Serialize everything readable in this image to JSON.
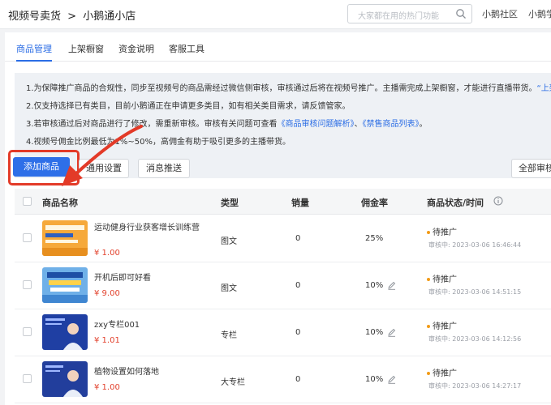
{
  "header": {
    "breadcrumb": [
      "视频号卖货",
      ">",
      "小鹅通小店"
    ],
    "search_placeholder": "大家都在用的热门功能",
    "links": [
      "小鹅社区",
      "小鹅学"
    ]
  },
  "tabs": [
    "商品管理",
    "上架橱窗",
    "资金说明",
    "客服工具"
  ],
  "notice": {
    "line1": "1.为保障推广商品的合规性，同步至视频号的商品需经过微信侧审核，审核通过后将在视频号推广。主播需完成上架橱窗，才能进行直播带货。",
    "line1_link": "“上架",
    "line2": "2.仅支持选择已有类目，目前小鹅通正在申请更多类目，如有相关类目需求，请反馈管家。",
    "line3_a": "3.若审核通过后对商品进行了修改，需重新审核。审核有关问题可查看",
    "line3_link1": "《商品审核问题解析》",
    "line3_sep": "、",
    "line3_link2": "《禁售商品列表》",
    "line3_end": "。",
    "line4": "4.视频号佣金比例最低为1%~50%，高佣金有助于吸引更多的主播带货。"
  },
  "toolbar": {
    "add_label": "添加商品",
    "general_label": "通用设置",
    "push_label": "消息推送",
    "filter_label": "全部审核"
  },
  "table": {
    "columns": [
      "商品名称",
      "类型",
      "销量",
      "佣金率",
      "商品状态/时间"
    ],
    "rows": [
      {
        "name": "运动健身行业获客增长训练营",
        "price": "¥ 1.00",
        "type": "图文",
        "sales": "0",
        "commission": "25%",
        "status": "待推广",
        "time": "审核中: 2023-03-06 16:46:44"
      },
      {
        "name": "开机后即可好看",
        "price": "¥ 9.00",
        "type": "图文",
        "sales": "0",
        "commission": "10%",
        "status": "待推广",
        "time": "审核中: 2023-03-06 14:51:15"
      },
      {
        "name": "zxy专栏001",
        "price": "¥ 1.01",
        "type": "专栏",
        "sales": "0",
        "commission": "10%",
        "status": "待推广",
        "time": "审核中: 2023-03-06 14:12:56"
      },
      {
        "name": "植物设置如何落地",
        "price": "¥ 1.00",
        "type": "大专栏",
        "sales": "0",
        "commission": "10%",
        "status": "待推广",
        "time": "审核中: 2023-03-06 14:27:17"
      }
    ]
  },
  "colors": {
    "primary": "#2e6fe8",
    "price": "#e2412c",
    "annotation": "#e33a28",
    "status_dot": "#f29b17"
  }
}
